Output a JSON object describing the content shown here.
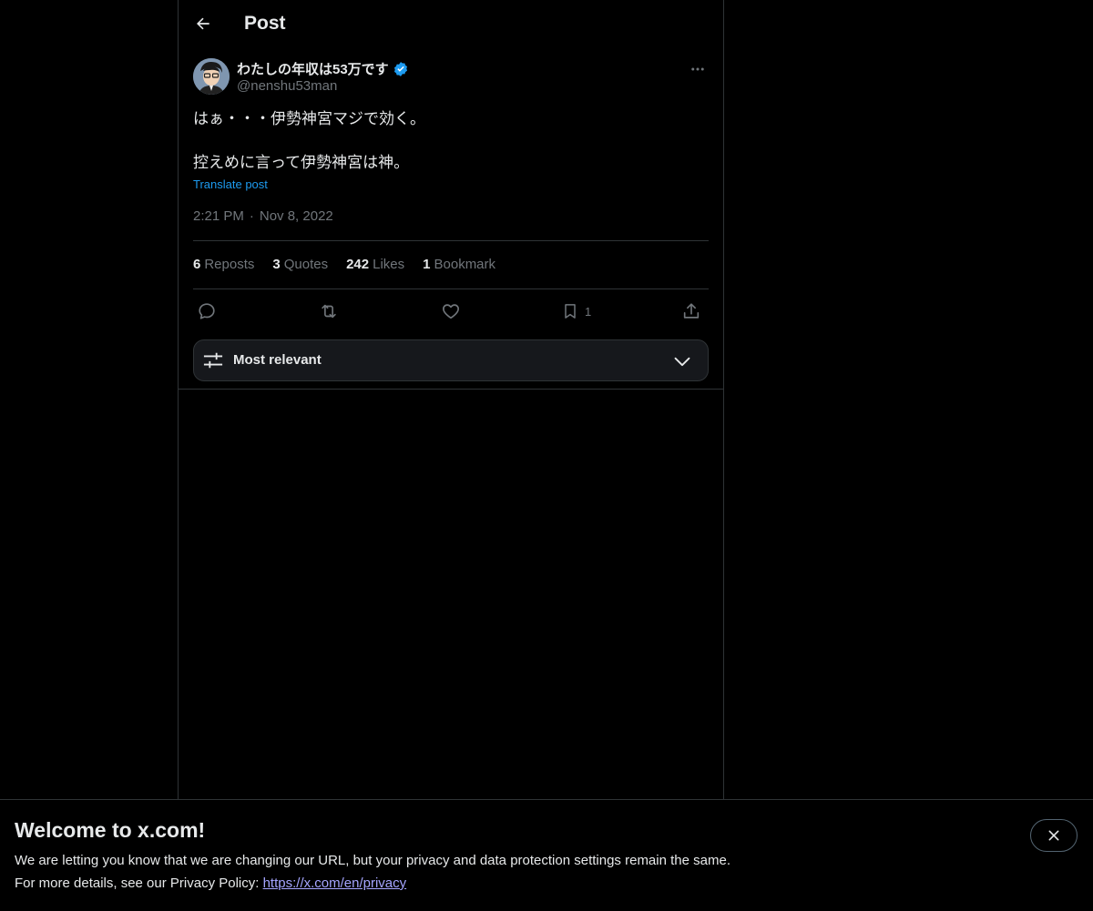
{
  "header": {
    "title": "Post"
  },
  "author": {
    "display_name": "わたしの年収は53万です",
    "handle": "@nenshu53man",
    "verified": true
  },
  "post": {
    "line1": "はぁ・・・伊勢神宮マジで効く。",
    "line2": "控えめに言って伊勢神宮は神。",
    "translate_label": "Translate post",
    "time": "2:21 PM",
    "separator": "·",
    "date": "Nov 8, 2022"
  },
  "stats": {
    "reposts_count": "6",
    "reposts_label": "Reposts",
    "quotes_count": "3",
    "quotes_label": "Quotes",
    "likes_count": "242",
    "likes_label": "Likes",
    "bookmarks_count": "1",
    "bookmarks_label": "Bookmark"
  },
  "actions": {
    "reply_icon": "reply-icon",
    "repost_icon": "repost-icon",
    "like_icon": "heart-icon",
    "bookmark_icon": "bookmark-icon",
    "bookmark_count": "1",
    "share_icon": "share-icon"
  },
  "sort": {
    "label": "Most relevant"
  },
  "banner": {
    "title": "Welcome to x.com!",
    "line1": "We are letting you know that we are changing our URL, but your privacy and data protection settings remain the same.",
    "line2_prefix": "For more details, see our Privacy Policy: ",
    "link": "https://x.com/en/privacy"
  },
  "colors": {
    "background": "#000000",
    "accent": "#1d9bf0",
    "muted": "#71767b",
    "border": "#2f3336"
  }
}
